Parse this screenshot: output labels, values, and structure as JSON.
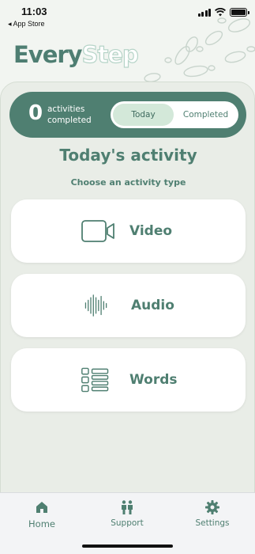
{
  "status_bar": {
    "time": "11:03",
    "back_label": "◂ App Store"
  },
  "logo": {
    "part1": "Every",
    "part2": "Step"
  },
  "stats": {
    "count": "0",
    "label": "activities completed"
  },
  "toggle": {
    "today": "Today",
    "completed": "Completed",
    "selected": "Today"
  },
  "main": {
    "heading": "Today's activity",
    "subheading": "Choose an activity type",
    "activities": [
      {
        "label": "Video",
        "icon": "video-camera-icon"
      },
      {
        "label": "Audio",
        "icon": "audio-waveform-icon"
      },
      {
        "label": "Words",
        "icon": "text-list-icon"
      }
    ]
  },
  "nav": {
    "items": [
      {
        "label": "Home",
        "icon": "home-icon"
      },
      {
        "label": "Support",
        "icon": "people-icon"
      },
      {
        "label": "Settings",
        "icon": "gear-icon"
      }
    ]
  },
  "colors": {
    "primary": "#4f7f71",
    "accent_light": "#d3e8d9",
    "background": "#f2f5f1",
    "card": "#e9ede7"
  }
}
